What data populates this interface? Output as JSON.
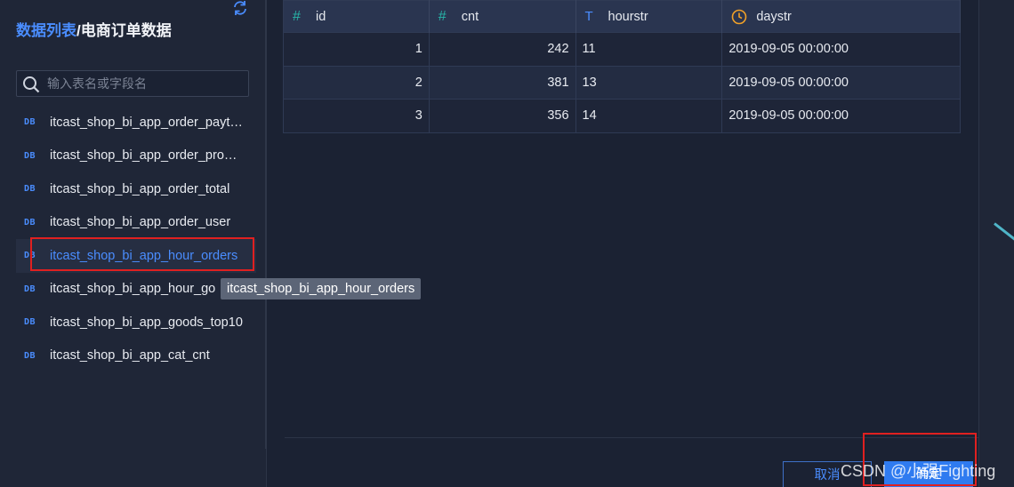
{
  "breadcrumb": {
    "root": "数据列表",
    "current": "/电商订单数据"
  },
  "search": {
    "placeholder": "输入表名或字段名"
  },
  "tables": [
    {
      "icon": "DB",
      "label": "itcast_shop_bi_app_order_payt…"
    },
    {
      "icon": "DB",
      "label": "itcast_shop_bi_app_order_pro…"
    },
    {
      "icon": "DB",
      "label": "itcast_shop_bi_app_order_total"
    },
    {
      "icon": "DB",
      "label": "itcast_shop_bi_app_order_user"
    },
    {
      "icon": "DB",
      "label": "itcast_shop_bi_app_hour_orders"
    },
    {
      "icon": "DB",
      "label": "itcast_shop_bi_app_hour_go"
    },
    {
      "icon": "DB",
      "label": "itcast_shop_bi_app_goods_top10"
    },
    {
      "icon": "DB",
      "label": "itcast_shop_bi_app_cat_cnt"
    }
  ],
  "active_table_index": 4,
  "tooltip": {
    "text": "itcast_shop_bi_app_hour_orders"
  },
  "grid": {
    "columns": [
      {
        "icon": "hash-icon",
        "glyph": "#",
        "label": "id"
      },
      {
        "icon": "hash-icon",
        "glyph": "#",
        "label": "cnt"
      },
      {
        "icon": "text-type-icon",
        "glyph": "T",
        "label": "hourstr"
      },
      {
        "icon": "clock-icon",
        "glyph": "",
        "label": "daystr"
      }
    ],
    "rows": [
      [
        "1",
        "242",
        "11",
        "2019-09-05 00:00:00"
      ],
      [
        "2",
        "381",
        "13",
        "2019-09-05 00:00:00"
      ],
      [
        "3",
        "356",
        "14",
        "2019-09-05 00:00:00"
      ]
    ]
  },
  "buttons": {
    "cancel": "取消",
    "ok": "确定"
  },
  "watermark": "CSDN @小强Fighting",
  "colors": {
    "accent": "#4a8dff",
    "highlight_box": "#e02020",
    "number_icon": "#28b4a8",
    "date_icon": "#f0a028"
  }
}
